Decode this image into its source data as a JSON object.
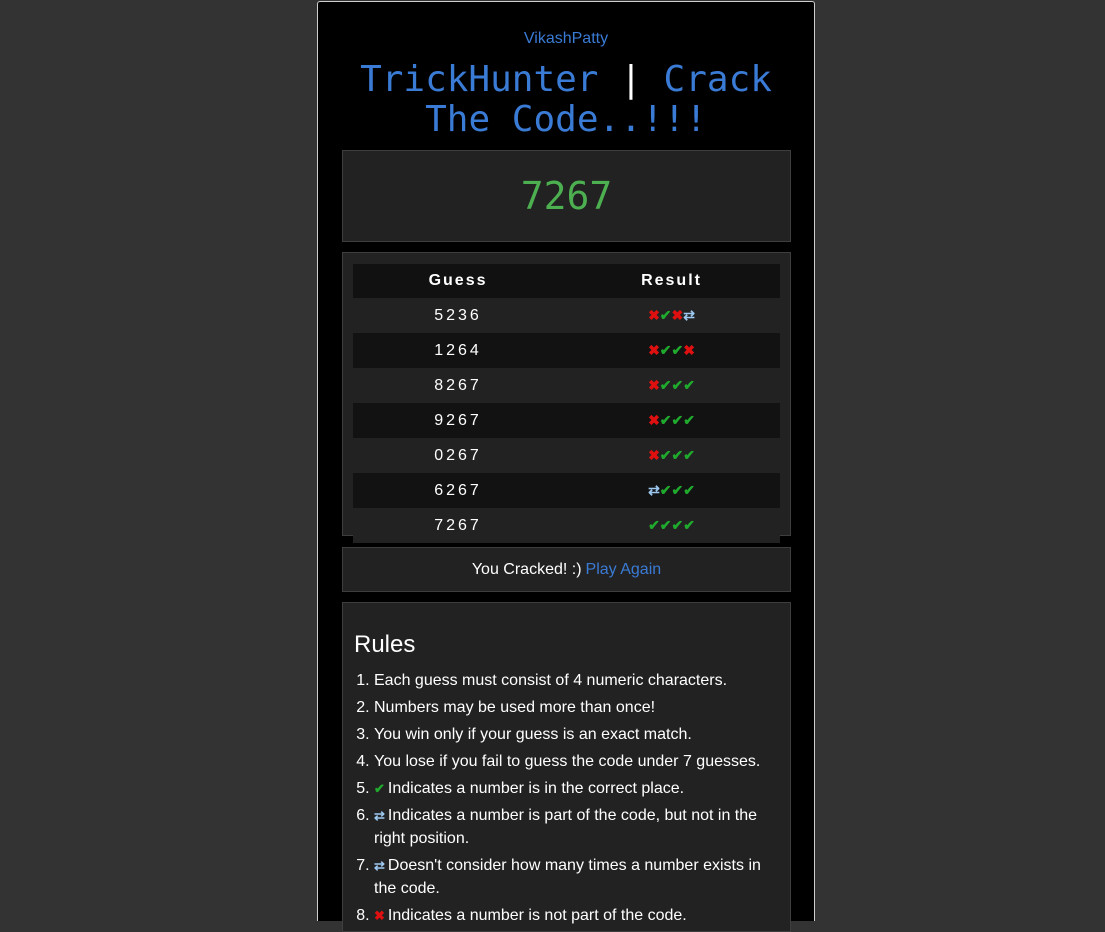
{
  "header": {
    "author": "VikashPatty",
    "title_left": "TrickHunter",
    "title_sep": "|",
    "title_right": "Crack The Code..!!!"
  },
  "code_display": "7267",
  "table": {
    "col_guess": "Guess",
    "col_result": "Result",
    "rows": [
      {
        "guess": "5236",
        "result": [
          "wrong",
          "correct",
          "wrong",
          "misplaced"
        ]
      },
      {
        "guess": "1264",
        "result": [
          "wrong",
          "correct",
          "correct",
          "wrong"
        ]
      },
      {
        "guess": "8267",
        "result": [
          "wrong",
          "correct",
          "correct",
          "correct"
        ]
      },
      {
        "guess": "9267",
        "result": [
          "wrong",
          "correct",
          "correct",
          "correct"
        ]
      },
      {
        "guess": "0267",
        "result": [
          "wrong",
          "correct",
          "correct",
          "correct"
        ]
      },
      {
        "guess": "6267",
        "result": [
          "misplaced",
          "correct",
          "correct",
          "correct"
        ]
      },
      {
        "guess": "7267",
        "result": [
          "correct",
          "correct",
          "correct",
          "correct"
        ]
      }
    ]
  },
  "status": {
    "message": "You Cracked! :)",
    "play_again": "Play Again"
  },
  "rules": {
    "title": "Rules",
    "items": [
      {
        "icon": null,
        "text": "Each guess must consist of 4 numeric characters."
      },
      {
        "icon": null,
        "text": "Numbers may be used more than once!"
      },
      {
        "icon": null,
        "text": "You win only if your guess is an exact match."
      },
      {
        "icon": null,
        "text": "You lose if you fail to guess the code under 7 guesses."
      },
      {
        "icon": "correct",
        "text": "Indicates a number is in the correct place."
      },
      {
        "icon": "misplaced",
        "text": "Indicates a number is part of the code, but not in the right position."
      },
      {
        "icon": "misplaced",
        "text": "Doesn't consider how many times a number exists in the code."
      },
      {
        "icon": "wrong",
        "text": "Indicates a number is not part of the code."
      }
    ]
  },
  "icons": {
    "correct": "check-icon",
    "wrong": "cross-icon",
    "misplaced": "swap-arrows-icon"
  },
  "colors": {
    "accent": "#3a7bd5",
    "code": "#4caf50",
    "correct": "#1faa2d",
    "wrong": "#e01010",
    "misplaced": "#9cc8f0"
  }
}
